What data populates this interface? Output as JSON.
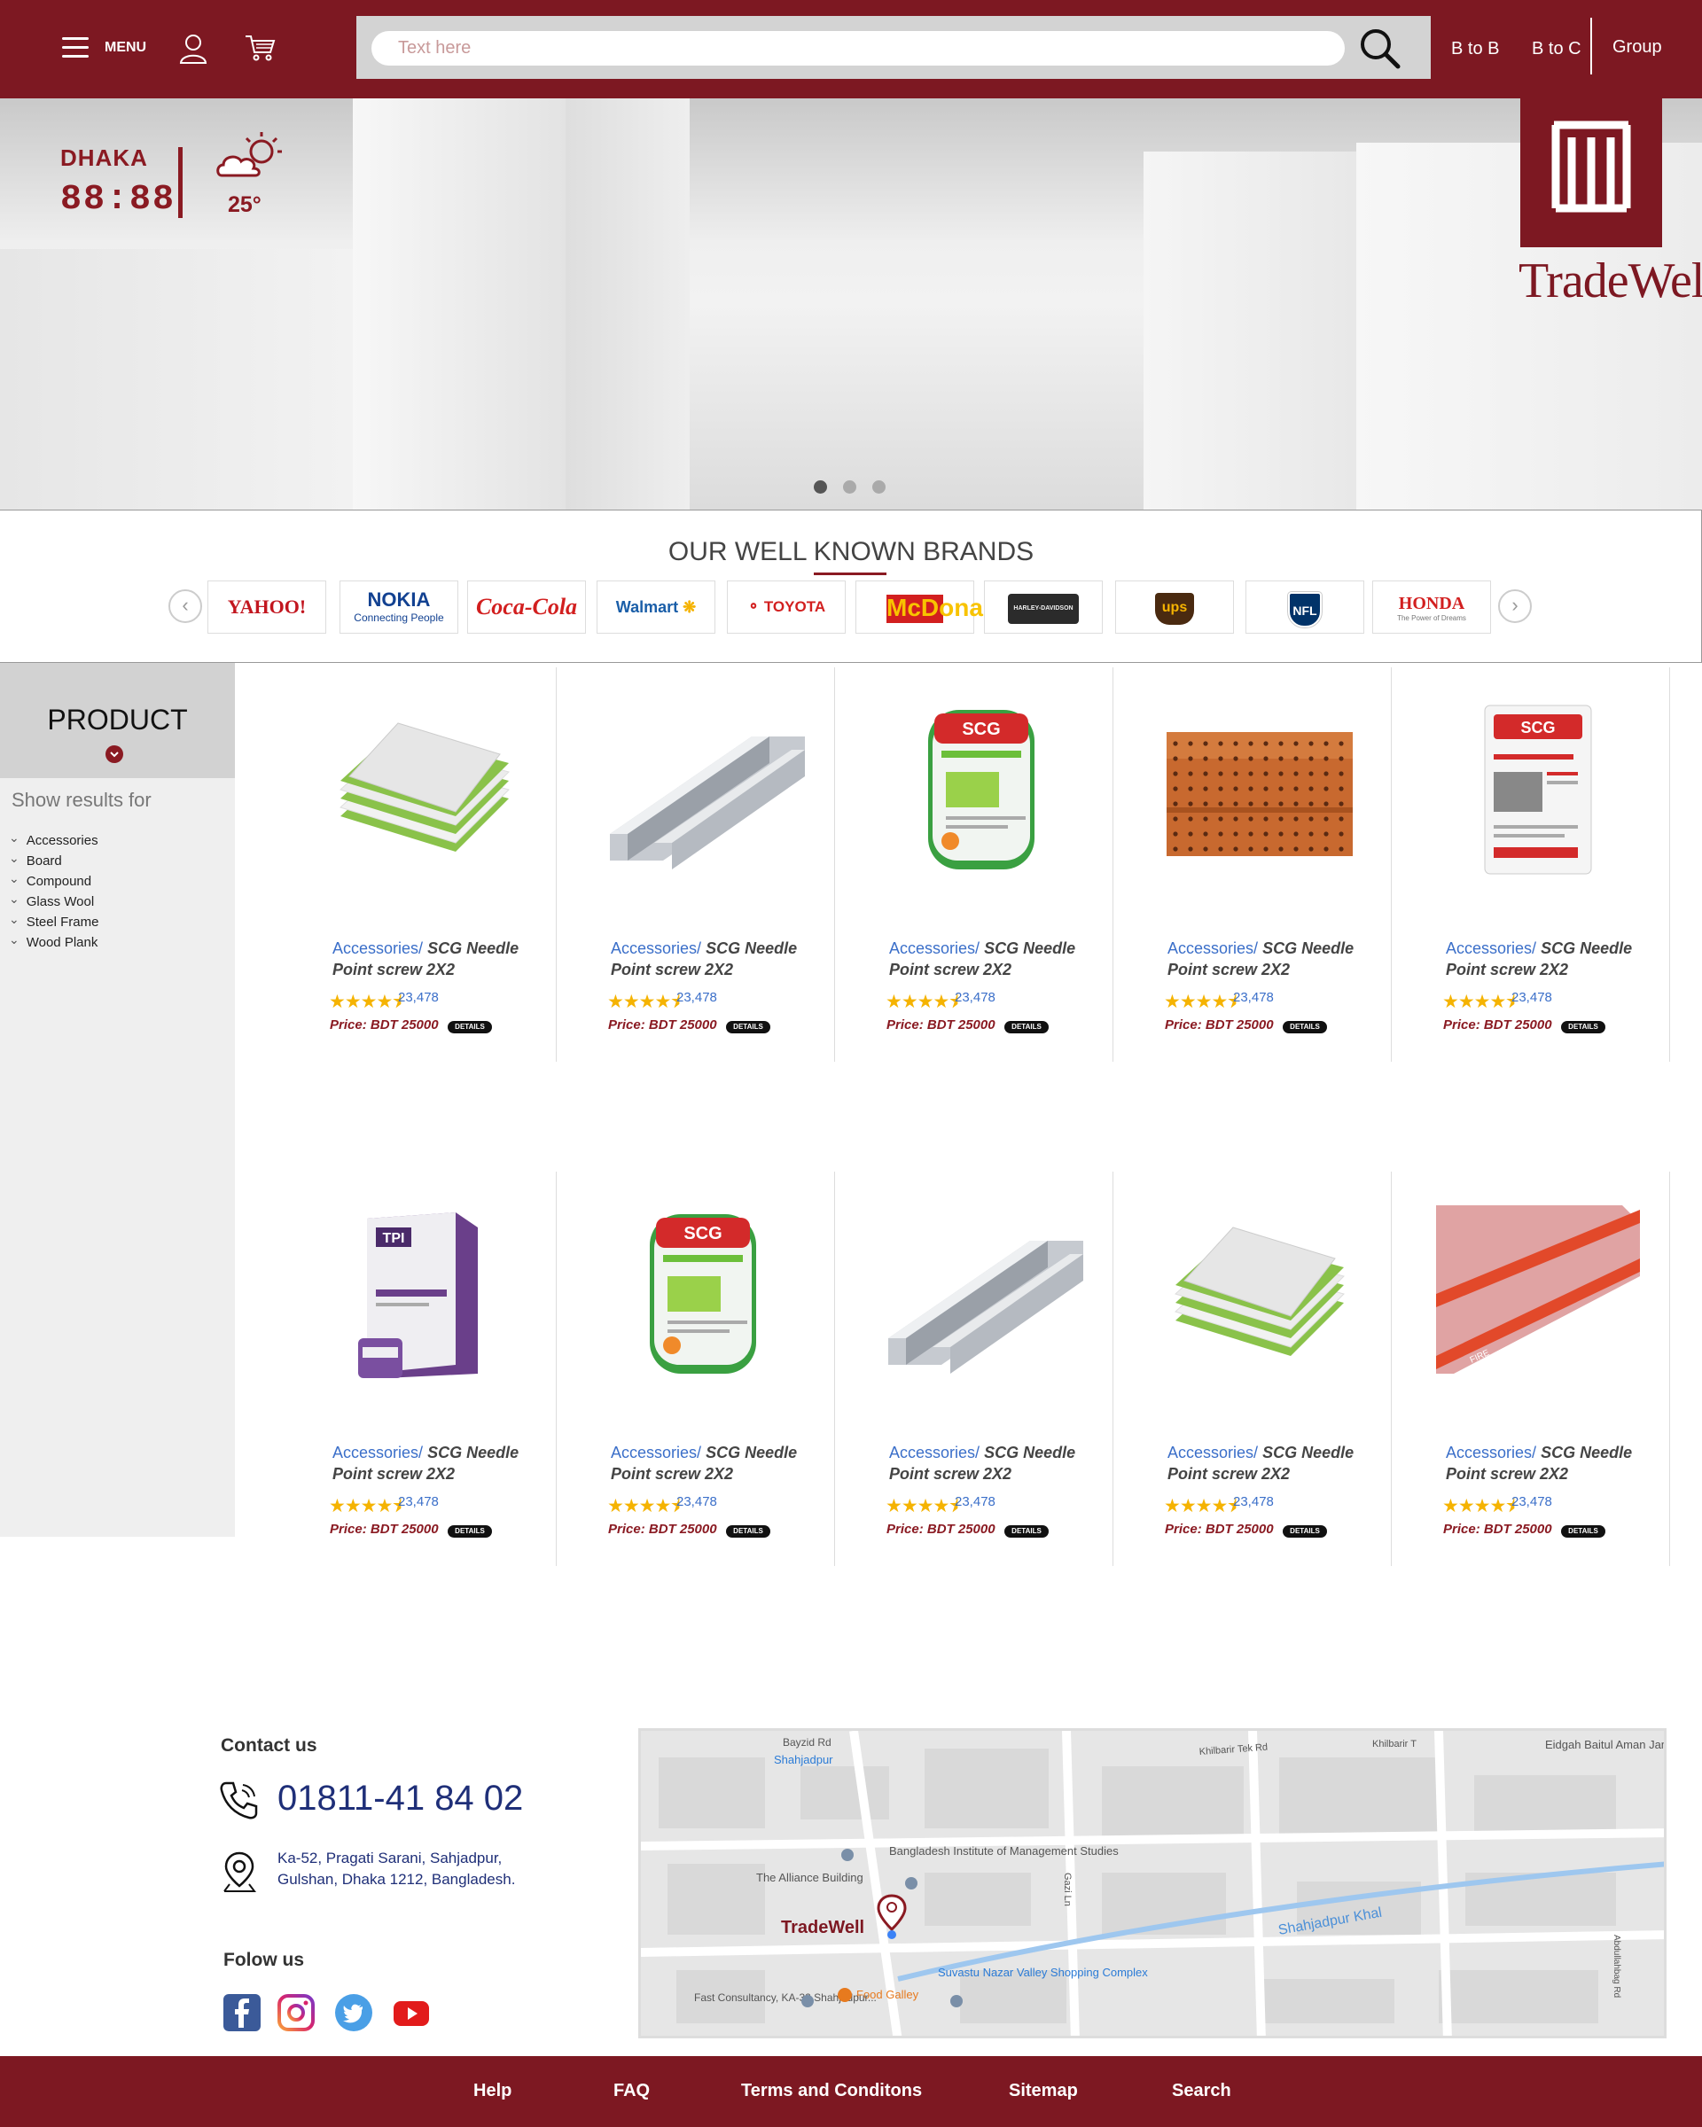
{
  "header": {
    "menu_label": "MENU",
    "search_placeholder": "Text here",
    "nav": {
      "b2b": "B to B",
      "b2c": "B to C",
      "group": "Group"
    }
  },
  "hero": {
    "city": "DHAKA",
    "time": "88:88",
    "temperature": "25°",
    "brand_name": "TradeWell",
    "slides": 3,
    "active_slide": 1
  },
  "brands": {
    "title": "OUR WELL KNOWN BRANDS",
    "items": [
      "YAHOO!",
      "NOKIA",
      "Coca-Cola",
      "Walmart",
      "TOYOTA",
      "McDonald's",
      "HARLEY-DAVIDSON",
      "ups",
      "NFL",
      "HONDA"
    ],
    "nokia_tagline": "Connecting People",
    "honda_tagline": "The Power of Dreams"
  },
  "sidebar": {
    "title": "PRODUCT",
    "subtitle": "Show results for",
    "categories": [
      "Accessories",
      "Board",
      "Compound",
      "Glass Wool",
      "Steel Frame",
      "Wood Plank"
    ]
  },
  "products": [
    {
      "category": "Accessories/",
      "name": "SCG Needle Point screw 2X2",
      "rating": 4.5,
      "reviews": "23,478",
      "price": "Price: BDT 25000",
      "details": "DETAILS",
      "image": "board-stack"
    },
    {
      "category": "Accessories/",
      "name": "SCG Needle Point screw 2X2",
      "rating": 4.5,
      "reviews": "23,478",
      "price": "Price: BDT 25000",
      "details": "DETAILS",
      "image": "steel-frame"
    },
    {
      "category": "Accessories/",
      "name": "SCG Needle Point screw 2X2",
      "rating": 4.5,
      "reviews": "23,478",
      "price": "Price: BDT 25000",
      "details": "DETAILS",
      "image": "glass-wool-roll"
    },
    {
      "category": "Accessories/",
      "name": "SCG Needle Point screw 2X2",
      "rating": 4.5,
      "reviews": "23,478",
      "price": "Price: BDT 25000",
      "details": "DETAILS",
      "image": "wood-plank"
    },
    {
      "category": "Accessories/",
      "name": "SCG Needle Point screw 2X2",
      "rating": 4.5,
      "reviews": "23,478",
      "price": "Price: BDT 25000",
      "details": "DETAILS",
      "image": "compound-bag"
    },
    {
      "category": "Accessories/",
      "name": "SCG Needle Point screw 2X2",
      "rating": 4.5,
      "reviews": "23,478",
      "price": "Price: BDT 25000",
      "details": "DETAILS",
      "image": "compound-box"
    },
    {
      "category": "Accessories/",
      "name": "SCG Needle Point screw 2X2",
      "rating": 4.5,
      "reviews": "23,478",
      "price": "Price: BDT 25000",
      "details": "DETAILS",
      "image": "glass-wool-roll"
    },
    {
      "category": "Accessories/",
      "name": "SCG Needle Point screw 2X2",
      "rating": 4.5,
      "reviews": "23,478",
      "price": "Price: BDT 25000",
      "details": "DETAILS",
      "image": "steel-frame"
    },
    {
      "category": "Accessories/",
      "name": "SCG Needle Point screw 2X2",
      "rating": 4.5,
      "reviews": "23,478",
      "price": "Price: BDT 25000",
      "details": "DETAILS",
      "image": "board-stack"
    },
    {
      "category": "Accessories/",
      "name": "SCG Needle Point screw 2X2",
      "rating": 4.5,
      "reviews": "23,478",
      "price": "Price: BDT 25000",
      "details": "DETAILS",
      "image": "gypsum-board"
    }
  ],
  "contact": {
    "title": "Contact us",
    "phone": "01811-41 84 02",
    "address_line1": "Ka-52, Pragati Sarani, Sahjadpur,",
    "address_line2": "Gulshan, Dhaka 1212, Bangladesh.",
    "follow_title": "Folow us",
    "socials": [
      "facebook-icon",
      "instagram-icon",
      "twitter-icon",
      "youtube-icon"
    ]
  },
  "map": {
    "marker_label": "TradeWell",
    "labels": {
      "bayzid": "Bayzid Rd",
      "shahjadpur": "Shahjadpur",
      "khilbari": "Khilbarir Tek Rd",
      "khilbari2": "Khilbarir T",
      "eidgah": "Eidgah Baitul Aman Jame Moshjid",
      "alliance": "The Alliance Building",
      "bims": "Bangladesh Institute of Management Studies",
      "gazi": "Gazi Ln",
      "khal": "Shahjadpur Khal",
      "suvastu": "Suvastu Nazar Valley Shopping Complex",
      "food": "Food Galley",
      "fast": "Fast Consultancy, KA-32 Shahjadpur...",
      "abdullah": "Abdullahbag Rd"
    }
  },
  "footer": {
    "links": [
      "Help",
      "FAQ",
      "Terms and Conditons",
      "Sitemap",
      "Search"
    ]
  },
  "colors": {
    "brand": "#7d1822",
    "link": "#3b6fc9",
    "star": "#f5b301"
  }
}
